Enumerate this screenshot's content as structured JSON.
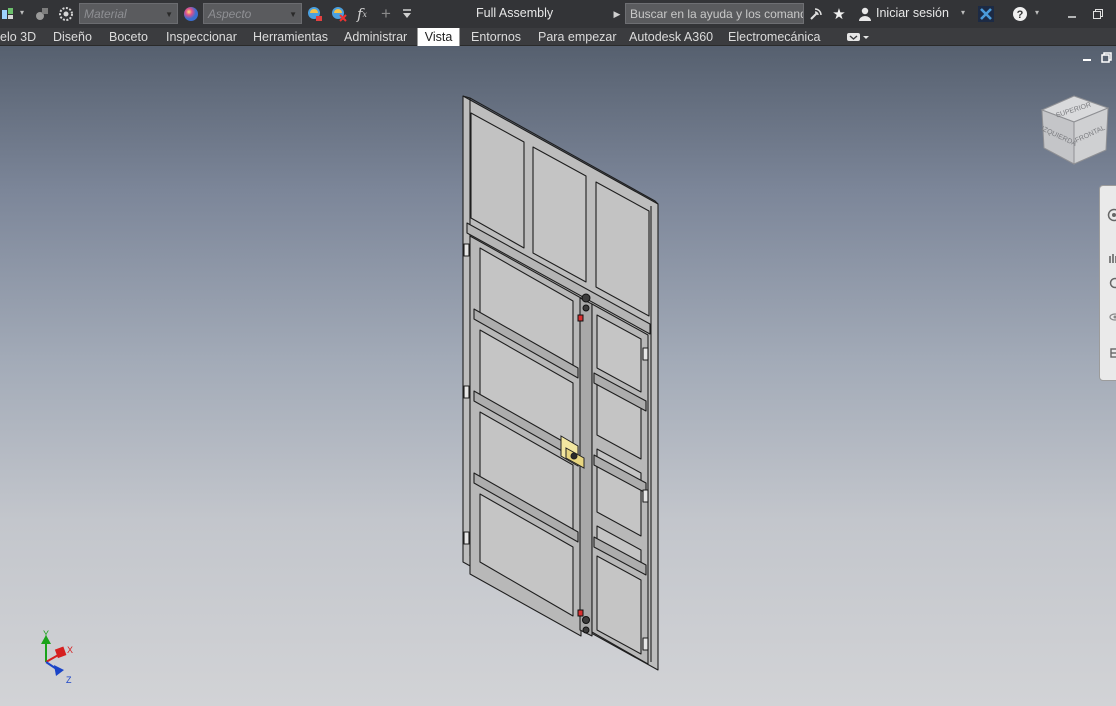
{
  "title_bar": {
    "material_combo": "Material",
    "appearance_combo": "Aspecto",
    "fx_label": "f",
    "fx_subscript": "x",
    "document_title": "Full Assembly",
    "search_placeholder": "Buscar en la ayuda y los comandos",
    "sign_in": "Iniciar sesión"
  },
  "ribbon_tabs": [
    {
      "label": "elo 3D"
    },
    {
      "label": "Diseño"
    },
    {
      "label": "Boceto"
    },
    {
      "label": "Inspeccionar"
    },
    {
      "label": "Herramientas"
    },
    {
      "label": "Administrar"
    },
    {
      "label": "Vista"
    },
    {
      "label": "Entornos"
    },
    {
      "label": "Para empezar"
    },
    {
      "label": "Autodesk A360"
    },
    {
      "label": "Electromecánica"
    }
  ],
  "active_tab": "Vista",
  "viewcube": {
    "faces": [
      "SUPERIOR",
      "IZQUIERDA",
      "FRONTAL"
    ]
  },
  "triad": {
    "x": "X",
    "y": "Y",
    "z": "Z"
  },
  "colors": {
    "titlebar": "#333437",
    "ribbon": "#3b3c3f",
    "accent": "#4a9bd9",
    "axis_x": "#d62020",
    "axis_y": "#1aa31a",
    "axis_z": "#1a44c8",
    "latch": "#f2e6a0"
  },
  "icons": {
    "qat": [
      "sketch-icon",
      "shapes-icon",
      "gear-icon",
      "appearance-ball-icon",
      "color-fill-icon",
      "clear-appearance-icon",
      "fx-icon",
      "crosshair-icon",
      "customize-icon"
    ],
    "right": [
      "nav-arrow-icon",
      "satellite-icon",
      "star-icon",
      "user-icon",
      "autodesk-x-icon",
      "help-icon",
      "minimize-icon",
      "restore-icon"
    ]
  }
}
